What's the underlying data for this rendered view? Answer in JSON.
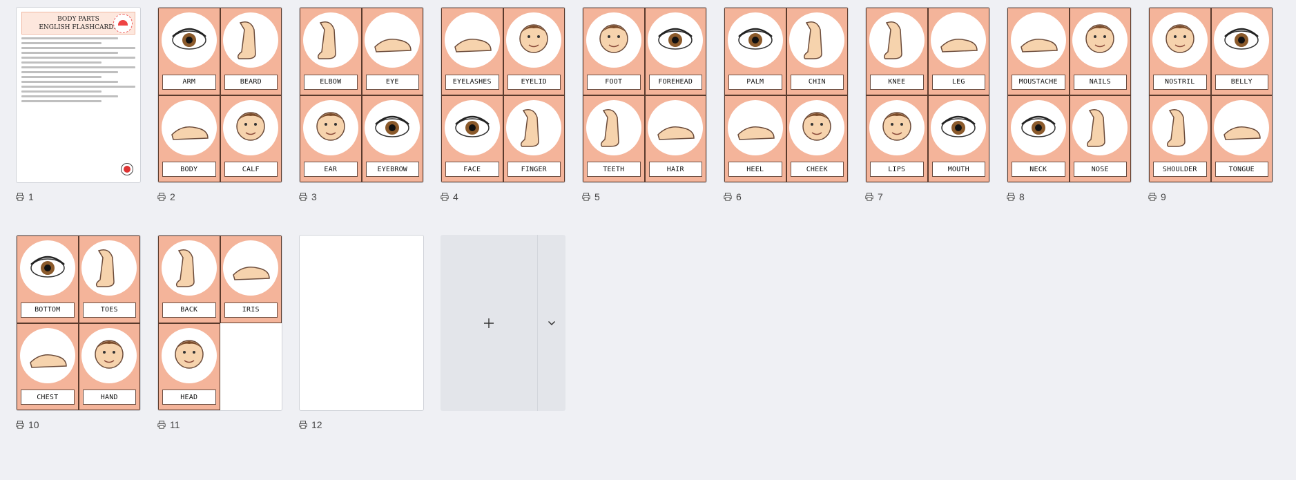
{
  "pages": [
    {
      "number": "1",
      "type": "title",
      "title_line1": "BODY PARTS",
      "title_line2": "ENGLISH FLASHCARDS"
    },
    {
      "number": "2",
      "cards": [
        "ARM",
        "BEARD",
        "BODY",
        "CALF"
      ]
    },
    {
      "number": "3",
      "cards": [
        "ELBOW",
        "EYE",
        "EAR",
        "EYEBROW"
      ]
    },
    {
      "number": "4",
      "cards": [
        "EYELASHES",
        "EYELID",
        "FACE",
        "FINGER"
      ]
    },
    {
      "number": "5",
      "cards": [
        "FOOT",
        "FOREHEAD",
        "TEETH",
        "HAIR"
      ]
    },
    {
      "number": "6",
      "cards": [
        "PALM",
        "CHIN",
        "HEEL",
        "CHEEK"
      ]
    },
    {
      "number": "7",
      "cards": [
        "KNEE",
        "LEG",
        "LIPS",
        "MOUTH"
      ]
    },
    {
      "number": "8",
      "cards": [
        "MOUSTACHE",
        "NAILS",
        "NECK",
        "NOSE"
      ]
    },
    {
      "number": "9",
      "cards": [
        "NOSTRIL",
        "BELLY",
        "SHOULDER",
        "TONGUE"
      ]
    },
    {
      "number": "10",
      "cards": [
        "BOTTOM",
        "TOES",
        "CHEST",
        "HAND"
      ]
    },
    {
      "number": "11",
      "cards": [
        "BACK",
        "IRIS",
        "HEAD",
        ""
      ]
    },
    {
      "number": "12",
      "type": "blank"
    }
  ],
  "colors": {
    "card_bg": "#f4b49a",
    "card_border": "#5a3a2c",
    "page_bg": "#eff0f4",
    "accent": "#e44"
  },
  "icons": {
    "page_number": "printer-icon",
    "add": "plus-icon",
    "more": "chevron-down-icon"
  }
}
